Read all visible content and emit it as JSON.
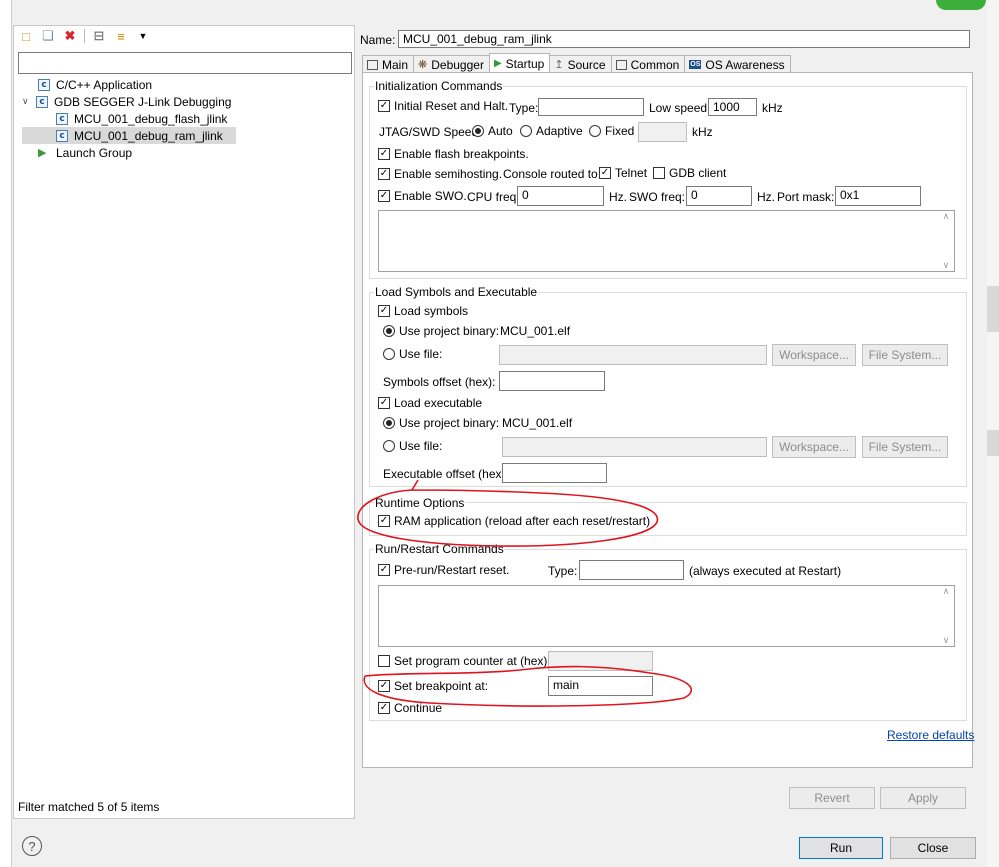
{
  "toolbar": {
    "icons": [
      "new-config-icon",
      "duplicate-icon",
      "delete-icon",
      "collapse-icon",
      "filter-icon",
      "dropdown-arrow-icon"
    ]
  },
  "filter": {
    "value": ""
  },
  "tree": {
    "items": [
      {
        "label": "C/C++ Application"
      },
      {
        "label": "GDB SEGGER J-Link Debugging"
      },
      {
        "label": "MCU_001_debug_flash_jlink"
      },
      {
        "label": "MCU_001_debug_ram_jlink"
      },
      {
        "label": "Launch Group"
      }
    ],
    "status": "Filter matched 5 of 5 items"
  },
  "name": {
    "label": "Name:",
    "value": "MCU_001_debug_ram_jlink"
  },
  "tabs": [
    "Main",
    "Debugger",
    "Startup",
    "Source",
    "Common",
    "OS Awareness"
  ],
  "init": {
    "title": "Initialization Commands",
    "initial_reset": "Initial Reset and Halt.",
    "type_label": "Type:",
    "type_value": "",
    "low_speed_label": "Low speed:",
    "low_speed_value": "1000",
    "khz": "kHz",
    "jtag_label": "JTAG/SWD Speed:",
    "auto": "Auto",
    "adaptive": "Adaptive",
    "fixed": "Fixed",
    "flash_bp": "Enable flash breakpoints.",
    "semihosting": "Enable semihosting.",
    "console_label": "Console routed to:",
    "telnet": "Telnet",
    "gdb_client": "GDB client",
    "swo": "Enable SWO.",
    "cpu_freq_label": "CPU freq:",
    "cpu_freq_value": "0",
    "hz": "Hz.",
    "swo_freq_label": "SWO freq:",
    "swo_freq_value": "0",
    "hz2": "Hz.",
    "port_mask_label": "Port mask:",
    "port_mask_value": "0x1"
  },
  "load": {
    "title": "Load Symbols and Executable",
    "load_symbols": "Load symbols",
    "use_project_binary": "Use project binary:",
    "binary_value": "MCU_001.elf",
    "use_file": "Use file:",
    "workspace": "Workspace...",
    "file_system": "File System...",
    "symbols_offset": "Symbols offset (hex):",
    "load_executable": "Load executable",
    "use_project_binary2": "Use project binary:",
    "binary_value2": "MCU_001.elf",
    "use_file2": "Use file:",
    "workspace2": "Workspace...",
    "file_system2": "File System...",
    "exec_offset": "Executable offset (hex):"
  },
  "runtime": {
    "title": "Runtime Options",
    "ram_app": "RAM application (reload after each reset/restart)"
  },
  "run": {
    "title": "Run/Restart Commands",
    "prerun": "Pre-run/Restart reset.",
    "type_label": "Type:",
    "always": "(always executed at Restart)",
    "set_pc": "Set program counter at (hex):",
    "set_bp": "Set breakpoint at:",
    "bp_value": "main",
    "continue": "Continue"
  },
  "restore_defaults": "Restore defaults",
  "buttons": {
    "revert": "Revert",
    "apply": "Apply",
    "run": "Run",
    "close": "Close"
  },
  "help": "?",
  "annotation_color": "#e0141e"
}
